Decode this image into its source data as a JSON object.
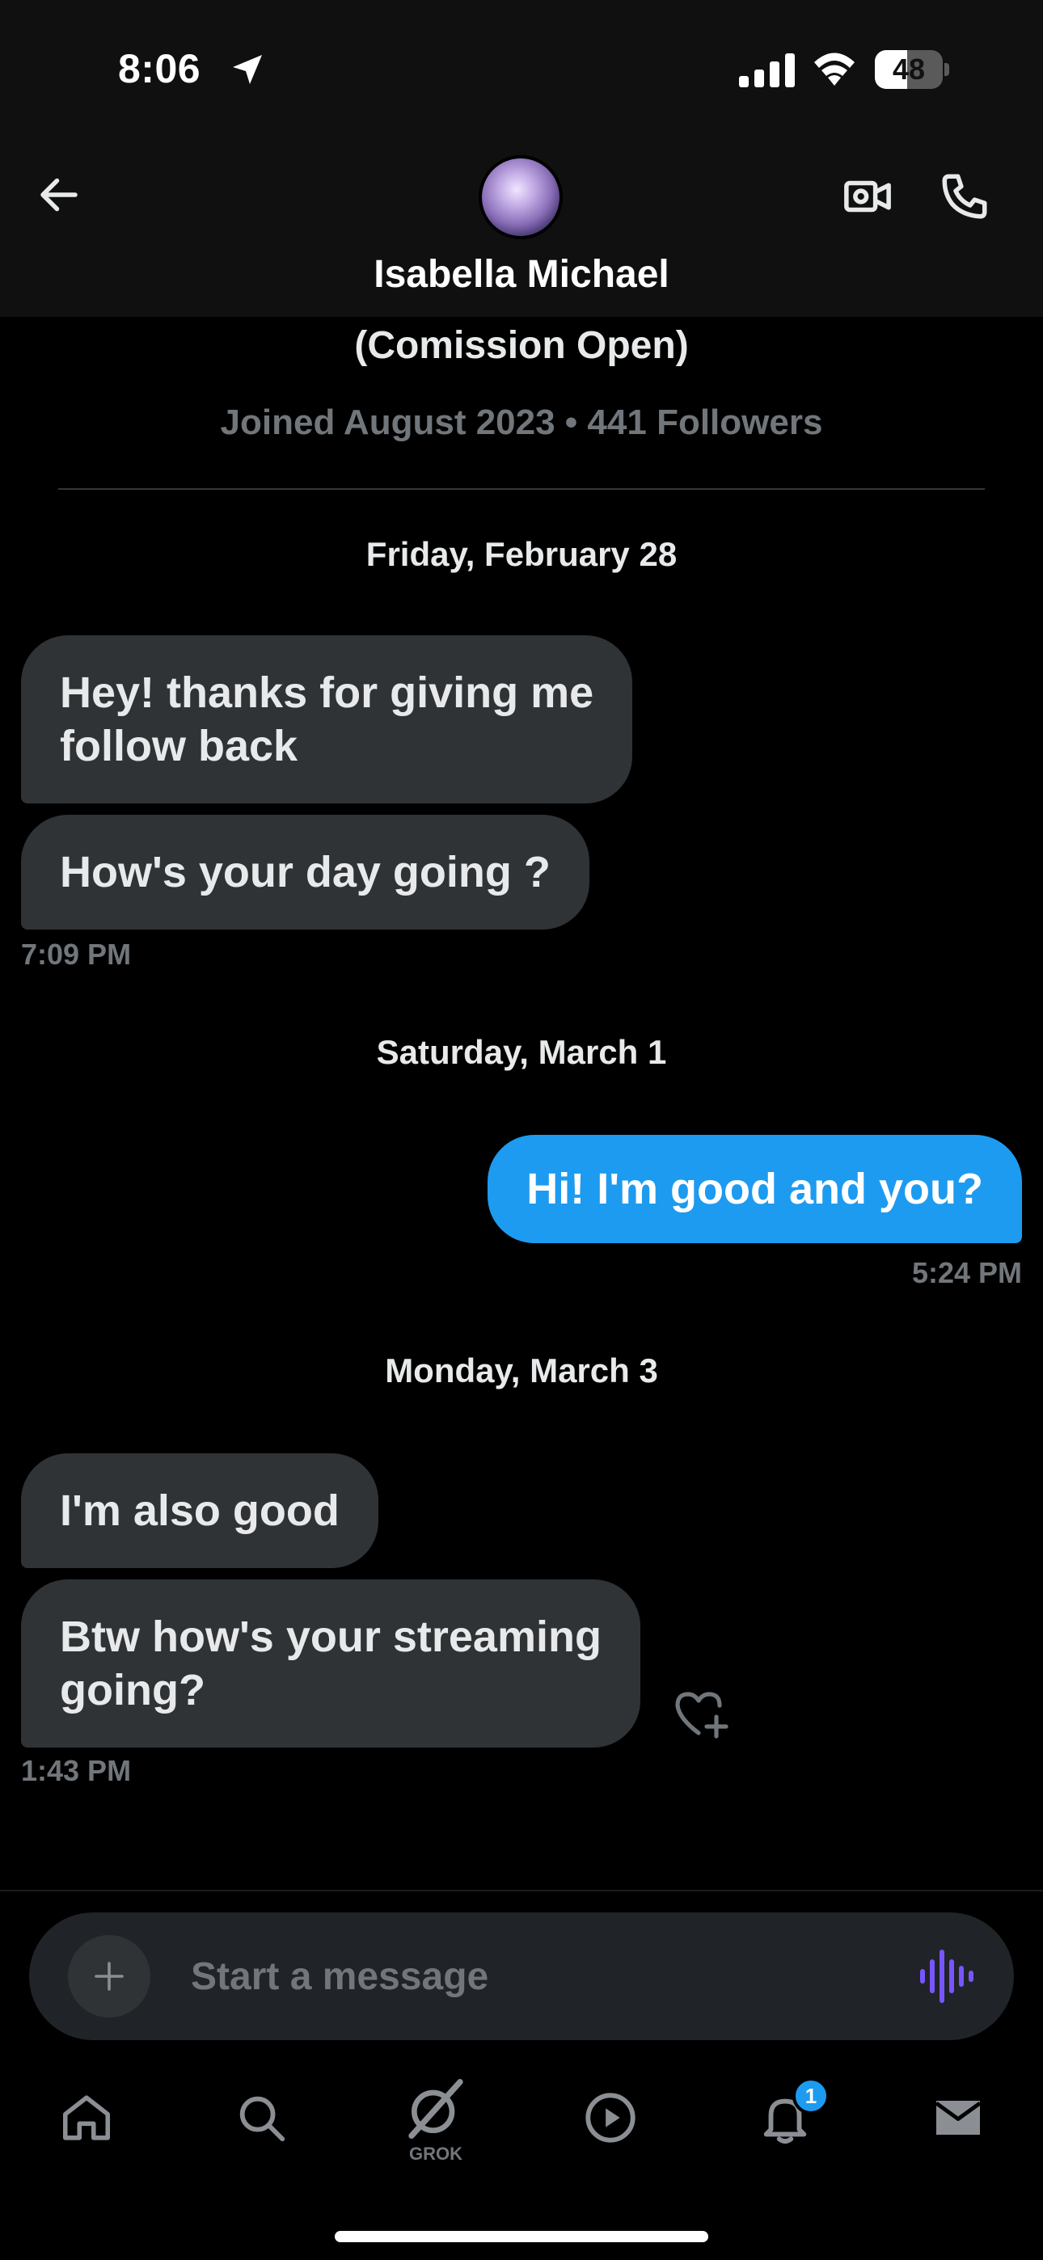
{
  "status_bar": {
    "time": "8:06",
    "battery_level": 48,
    "battery_label": "48"
  },
  "header": {
    "contact_name": "Isabella Michael"
  },
  "profile": {
    "bio_line": "(Comission Open)",
    "meta": "Joined August 2023 • 441 Followers"
  },
  "conversation": {
    "groups": [
      {
        "date": "Friday, February 28",
        "messages": [
          {
            "direction": "incoming",
            "text_lines": [
              "Hey! thanks for giving me",
              "follow back"
            ]
          },
          {
            "direction": "incoming",
            "text_lines": [
              "How's your day going ?"
            ]
          }
        ],
        "time": "7:09 PM"
      },
      {
        "date": "Saturday, March 1",
        "messages": [
          {
            "direction": "outgoing",
            "text_lines": [
              "Hi! I'm good and you?"
            ]
          }
        ],
        "time": "5:24 PM"
      },
      {
        "date": "Monday, March 3",
        "messages": [
          {
            "direction": "incoming",
            "text_lines": [
              "I'm also good"
            ]
          },
          {
            "direction": "incoming",
            "text_lines": [
              "Btw how's your streaming",
              "going?"
            ]
          }
        ],
        "time": "1:43 PM"
      }
    ]
  },
  "composer": {
    "placeholder": "Start a message"
  },
  "nav": {
    "items": [
      "home-icon",
      "search-icon",
      "grok-icon",
      "video-play-icon",
      "notifications-icon",
      "messages-icon"
    ],
    "grok_label": "GROK",
    "notification_count": "1"
  },
  "colors": {
    "accent": "#1d9bf0",
    "incoming_bubble": "#2f3336",
    "muted": "#71767b",
    "voice": "#7856ff"
  }
}
